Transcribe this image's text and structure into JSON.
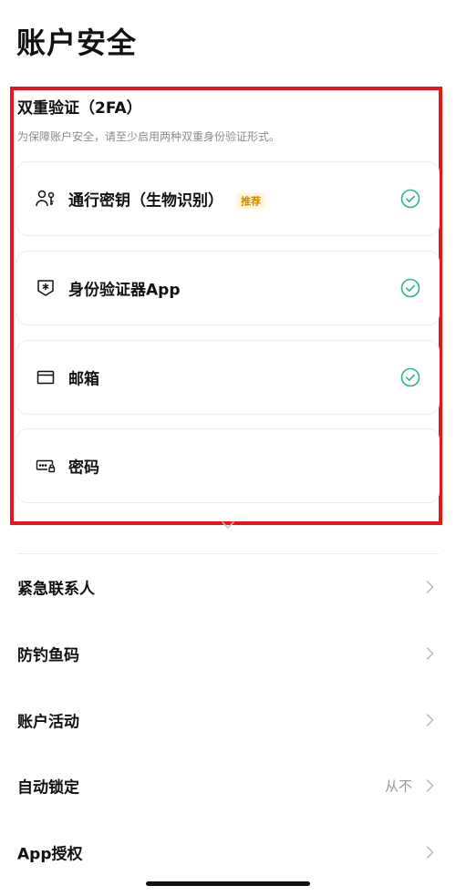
{
  "page": {
    "title": "账户安全"
  },
  "tfa": {
    "title": "双重验证（2FA）",
    "description": "为保障账户安全，请至少启用两种双重身份验证形式。",
    "methods": [
      {
        "label": "通行密钥（生物识别）",
        "badge": "推荐",
        "icon": "passkey-icon",
        "enabled": true
      },
      {
        "label": "身份验证器App",
        "icon": "authenticator-icon",
        "enabled": true
      },
      {
        "label": "邮箱",
        "icon": "mail-icon",
        "enabled": true
      },
      {
        "label": "密码",
        "icon": "password-icon",
        "enabled": false
      }
    ]
  },
  "settings": {
    "items": [
      {
        "label": "紧急联系人",
        "value": ""
      },
      {
        "label": "防钓鱼码",
        "value": ""
      },
      {
        "label": "账户活动",
        "value": ""
      },
      {
        "label": "自动锁定",
        "value": "从不"
      },
      {
        "label": "App授权",
        "value": ""
      }
    ]
  },
  "colors": {
    "highlight_border": "#e8141a",
    "check_green": "#2bb38a",
    "badge_text": "#d08c00",
    "badge_bg": "#fff6dc",
    "muted_text": "#8c8c8c"
  }
}
